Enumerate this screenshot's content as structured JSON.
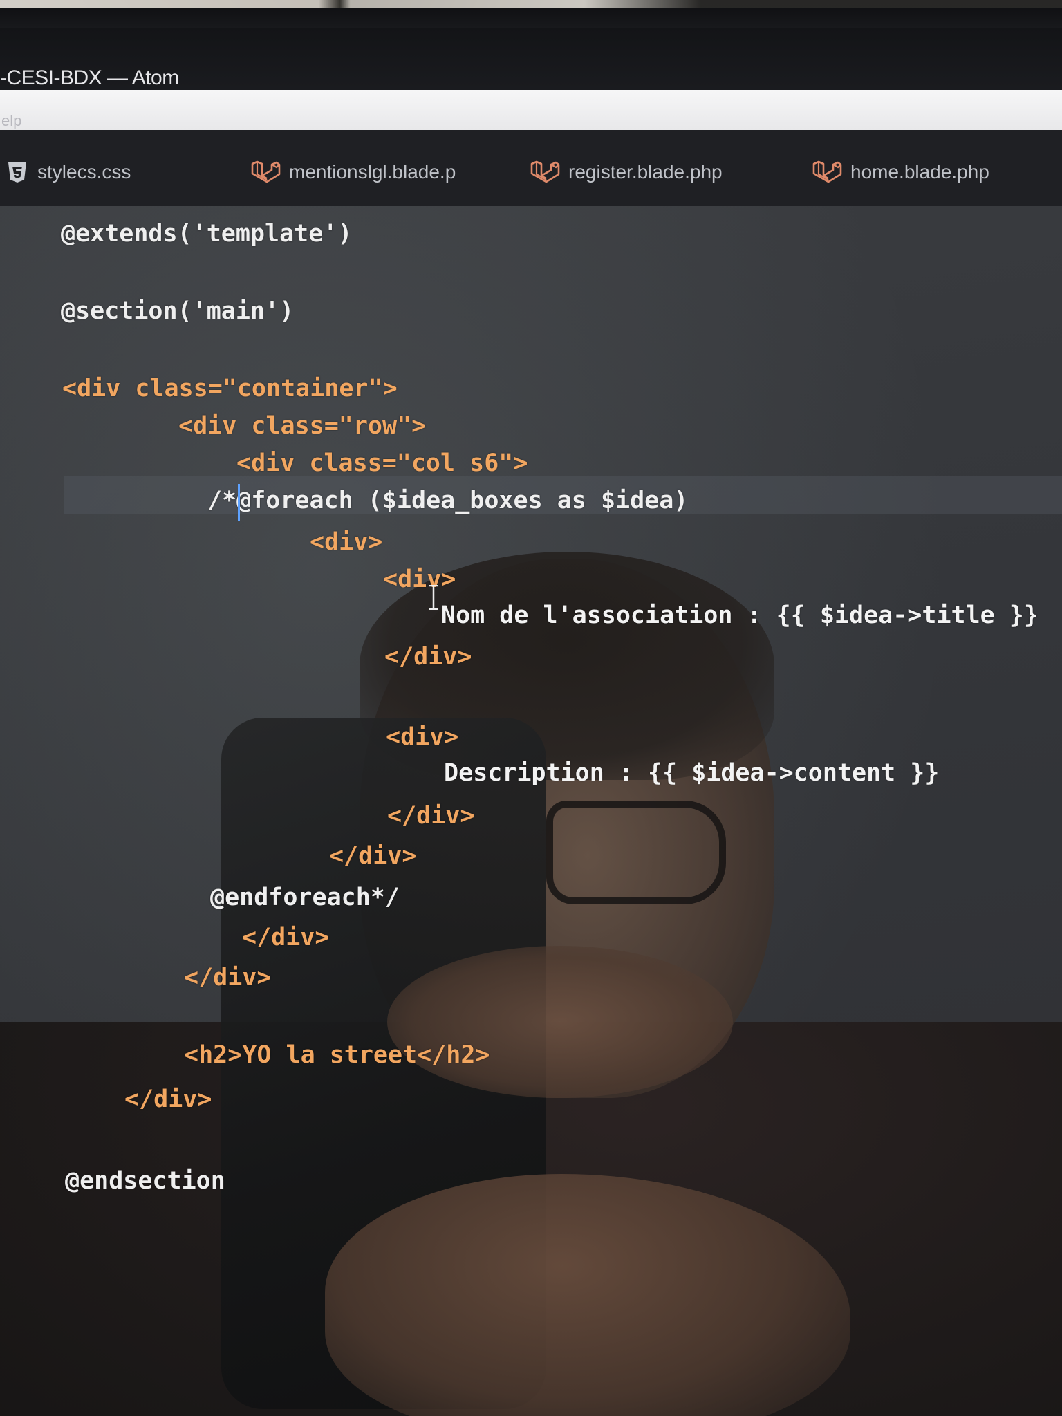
{
  "window": {
    "title": "-CESI-BDX — Atom",
    "menu_hint": "elp"
  },
  "tabs": [
    {
      "label": "stylecs.css",
      "icon": "css3-icon"
    },
    {
      "label": "mentionslgl.blade.p",
      "icon": "laravel-icon"
    },
    {
      "label": "register.blade.php",
      "icon": "laravel-icon"
    },
    {
      "label": "home.blade.php",
      "icon": "laravel-icon"
    }
  ],
  "code": {
    "line_extends": "@extends('template')",
    "line_section": "@section('main')",
    "line_container": "<div class=\"container\">",
    "line_row": "<div class=\"row\">",
    "line_col": "<div class=\"col s6\">",
    "line_foreach": "/*@foreach ($idea_boxes as $idea)",
    "line_div_open_1": "<div>",
    "line_div_open_2": "<div>",
    "line_nom": "Nom de l'association : {{ $idea->title }}",
    "line_div_close_1": "</div>",
    "line_div_open_3": "<div>",
    "line_description": "Description : {{ $idea->content }}",
    "line_div_close_2": "</div>",
    "line_div_close_3": "</div>",
    "line_endforeach": "@endforeach*/",
    "line_div_close_4": "</div>",
    "line_div_close_5": "</div>",
    "line_h2": "<h2>YO la street</h2>",
    "line_div_close_6": "</div>",
    "line_endsection": "@endsection"
  },
  "colors": {
    "tag": "#f2a660",
    "attribute": "#e7c372",
    "string": "#f2e8c7",
    "caret": "#5ea2ff",
    "tab_bar": "#1f2024"
  }
}
